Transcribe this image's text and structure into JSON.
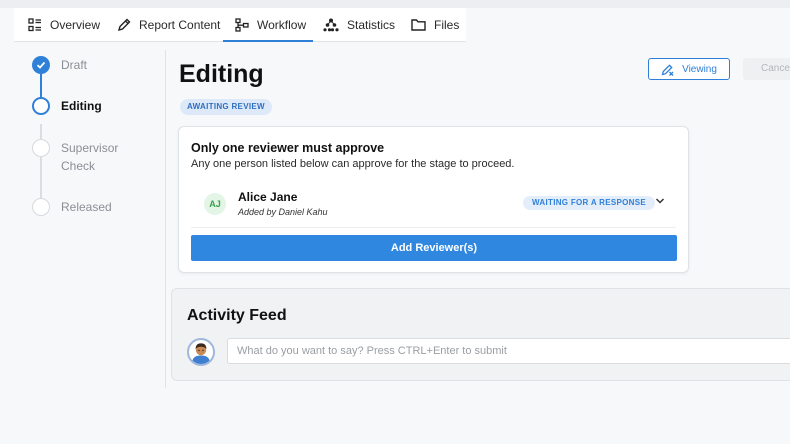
{
  "tabs": [
    {
      "label": "Overview",
      "icon": "list-icon"
    },
    {
      "label": "Report Content",
      "icon": "pencil-icon"
    },
    {
      "label": "Workflow",
      "icon": "workflow-icon",
      "active": true
    },
    {
      "label": "Statistics",
      "icon": "hierarchy-icon"
    },
    {
      "label": "Files",
      "icon": "folder-icon"
    }
  ],
  "steps": [
    {
      "label": "Draft",
      "state": "done"
    },
    {
      "label": "Editing",
      "state": "current"
    },
    {
      "label": "Supervisor Check",
      "state": "todo"
    },
    {
      "label": "Released",
      "state": "todo"
    }
  ],
  "stage": {
    "title": "Editing",
    "badge": "AWAITING REVIEW"
  },
  "actions": {
    "viewing_label": "Viewing",
    "cancel_label": "Cancel"
  },
  "approval": {
    "title": "Only one reviewer must approve",
    "subtitle": "Any one person listed below can approve for the stage to proceed.",
    "reviewer": {
      "initials": "AJ",
      "name": "Alice Jane",
      "added_by": "Added by Daniel Kahu",
      "status": "WAITING FOR A RESPONSE"
    },
    "add_button": "Add Reviewer(s)"
  },
  "activity": {
    "title": "Activity Feed",
    "placeholder": "What do you want to say? Press CTRL+Enter to submit"
  },
  "colors": {
    "accent": "#2f80d8",
    "primary_button": "#2f87e0",
    "avatar_green": "#3aa14a"
  }
}
